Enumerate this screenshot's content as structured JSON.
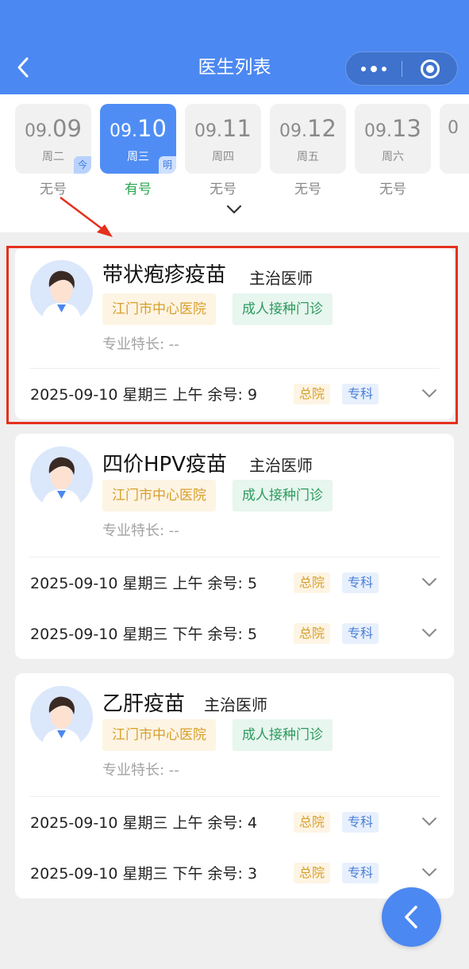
{
  "header": {
    "title": "医生列表",
    "bg_color": "#4c88f1",
    "back_icon": "chevron-left-icon",
    "menu_icon": "more-dots-icon",
    "close_icon": "target-circle-icon"
  },
  "dates": [
    {
      "month": "09.",
      "day": "09",
      "weekday": "周二",
      "badge": "今",
      "availability": "无号",
      "selected": false
    },
    {
      "month": "09.",
      "day": "10",
      "weekday": "周三",
      "badge": "明",
      "availability": "有号",
      "selected": true
    },
    {
      "month": "09.",
      "day": "11",
      "weekday": "周四",
      "badge": "",
      "availability": "无号",
      "selected": false
    },
    {
      "month": "09.",
      "day": "12",
      "weekday": "周五",
      "badge": "",
      "availability": "无号",
      "selected": false
    },
    {
      "month": "09.",
      "day": "13",
      "weekday": "周六",
      "badge": "",
      "availability": "无号",
      "selected": false
    },
    {
      "month": "0",
      "day": "",
      "weekday": "",
      "badge": "",
      "availability": "",
      "selected": false
    }
  ],
  "cards": [
    {
      "name": "带状疱疹疫苗",
      "rank": "主治医师",
      "hospital": "江门市中心医院",
      "clinic": "成人接种门诊",
      "specialty": "专业特长: --",
      "slots": [
        {
          "text": "2025-09-10 星期三 上午 余号: 9",
          "badge1": "总院",
          "badge2": "专科"
        }
      ]
    },
    {
      "name": "四价HPV疫苗",
      "rank": "主治医师",
      "hospital": "江门市中心医院",
      "clinic": "成人接种门诊",
      "specialty": "专业特长: --",
      "slots": [
        {
          "text": "2025-09-10 星期三 上午 余号: 5",
          "badge1": "总院",
          "badge2": "专科"
        },
        {
          "text": "2025-09-10 星期三 下午 余号: 5",
          "badge1": "总院",
          "badge2": "专科"
        }
      ]
    },
    {
      "name": "乙肝疫苗",
      "rank": "主治医师",
      "hospital": "江门市中心医院",
      "clinic": "成人接种门诊",
      "specialty": "专业特长: --",
      "slots": [
        {
          "text": "2025-09-10 星期三 上午 余号: 4",
          "badge1": "总院",
          "badge2": "专科"
        },
        {
          "text": "2025-09-10 星期三 下午 余号: 3",
          "badge1": "总院",
          "badge2": "专科"
        }
      ]
    }
  ],
  "fab_icon": "chevron-left-icon",
  "colors": {
    "accent": "#4c88f1",
    "available": "#2aa54e",
    "highlight": "#e5301e"
  }
}
